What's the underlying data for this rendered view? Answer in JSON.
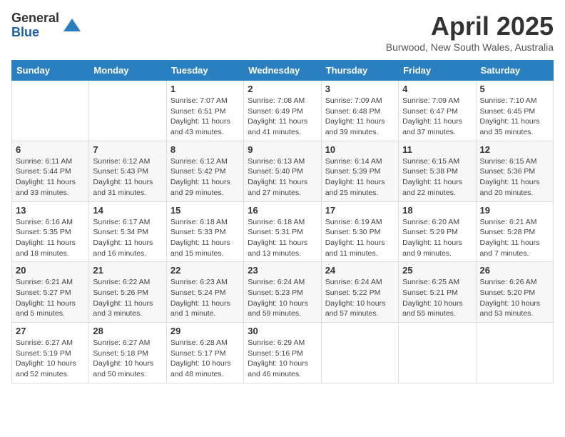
{
  "logo": {
    "general": "General",
    "blue": "Blue"
  },
  "title": "April 2025",
  "location": "Burwood, New South Wales, Australia",
  "days_of_week": [
    "Sunday",
    "Monday",
    "Tuesday",
    "Wednesday",
    "Thursday",
    "Friday",
    "Saturday"
  ],
  "weeks": [
    [
      {
        "day": "",
        "info": ""
      },
      {
        "day": "",
        "info": ""
      },
      {
        "day": "1",
        "info": "Sunrise: 7:07 AM\nSunset: 6:51 PM\nDaylight: 11 hours and 43 minutes."
      },
      {
        "day": "2",
        "info": "Sunrise: 7:08 AM\nSunset: 6:49 PM\nDaylight: 11 hours and 41 minutes."
      },
      {
        "day": "3",
        "info": "Sunrise: 7:09 AM\nSunset: 6:48 PM\nDaylight: 11 hours and 39 minutes."
      },
      {
        "day": "4",
        "info": "Sunrise: 7:09 AM\nSunset: 6:47 PM\nDaylight: 11 hours and 37 minutes."
      },
      {
        "day": "5",
        "info": "Sunrise: 7:10 AM\nSunset: 6:45 PM\nDaylight: 11 hours and 35 minutes."
      }
    ],
    [
      {
        "day": "6",
        "info": "Sunrise: 6:11 AM\nSunset: 5:44 PM\nDaylight: 11 hours and 33 minutes."
      },
      {
        "day": "7",
        "info": "Sunrise: 6:12 AM\nSunset: 5:43 PM\nDaylight: 11 hours and 31 minutes."
      },
      {
        "day": "8",
        "info": "Sunrise: 6:12 AM\nSunset: 5:42 PM\nDaylight: 11 hours and 29 minutes."
      },
      {
        "day": "9",
        "info": "Sunrise: 6:13 AM\nSunset: 5:40 PM\nDaylight: 11 hours and 27 minutes."
      },
      {
        "day": "10",
        "info": "Sunrise: 6:14 AM\nSunset: 5:39 PM\nDaylight: 11 hours and 25 minutes."
      },
      {
        "day": "11",
        "info": "Sunrise: 6:15 AM\nSunset: 5:38 PM\nDaylight: 11 hours and 22 minutes."
      },
      {
        "day": "12",
        "info": "Sunrise: 6:15 AM\nSunset: 5:36 PM\nDaylight: 11 hours and 20 minutes."
      }
    ],
    [
      {
        "day": "13",
        "info": "Sunrise: 6:16 AM\nSunset: 5:35 PM\nDaylight: 11 hours and 18 minutes."
      },
      {
        "day": "14",
        "info": "Sunrise: 6:17 AM\nSunset: 5:34 PM\nDaylight: 11 hours and 16 minutes."
      },
      {
        "day": "15",
        "info": "Sunrise: 6:18 AM\nSunset: 5:33 PM\nDaylight: 11 hours and 15 minutes."
      },
      {
        "day": "16",
        "info": "Sunrise: 6:18 AM\nSunset: 5:31 PM\nDaylight: 11 hours and 13 minutes."
      },
      {
        "day": "17",
        "info": "Sunrise: 6:19 AM\nSunset: 5:30 PM\nDaylight: 11 hours and 11 minutes."
      },
      {
        "day": "18",
        "info": "Sunrise: 6:20 AM\nSunset: 5:29 PM\nDaylight: 11 hours and 9 minutes."
      },
      {
        "day": "19",
        "info": "Sunrise: 6:21 AM\nSunset: 5:28 PM\nDaylight: 11 hours and 7 minutes."
      }
    ],
    [
      {
        "day": "20",
        "info": "Sunrise: 6:21 AM\nSunset: 5:27 PM\nDaylight: 11 hours and 5 minutes."
      },
      {
        "day": "21",
        "info": "Sunrise: 6:22 AM\nSunset: 5:26 PM\nDaylight: 11 hours and 3 minutes."
      },
      {
        "day": "22",
        "info": "Sunrise: 6:23 AM\nSunset: 5:24 PM\nDaylight: 11 hours and 1 minute."
      },
      {
        "day": "23",
        "info": "Sunrise: 6:24 AM\nSunset: 5:23 PM\nDaylight: 10 hours and 59 minutes."
      },
      {
        "day": "24",
        "info": "Sunrise: 6:24 AM\nSunset: 5:22 PM\nDaylight: 10 hours and 57 minutes."
      },
      {
        "day": "25",
        "info": "Sunrise: 6:25 AM\nSunset: 5:21 PM\nDaylight: 10 hours and 55 minutes."
      },
      {
        "day": "26",
        "info": "Sunrise: 6:26 AM\nSunset: 5:20 PM\nDaylight: 10 hours and 53 minutes."
      }
    ],
    [
      {
        "day": "27",
        "info": "Sunrise: 6:27 AM\nSunset: 5:19 PM\nDaylight: 10 hours and 52 minutes."
      },
      {
        "day": "28",
        "info": "Sunrise: 6:27 AM\nSunset: 5:18 PM\nDaylight: 10 hours and 50 minutes."
      },
      {
        "day": "29",
        "info": "Sunrise: 6:28 AM\nSunset: 5:17 PM\nDaylight: 10 hours and 48 minutes."
      },
      {
        "day": "30",
        "info": "Sunrise: 6:29 AM\nSunset: 5:16 PM\nDaylight: 10 hours and 46 minutes."
      },
      {
        "day": "",
        "info": ""
      },
      {
        "day": "",
        "info": ""
      },
      {
        "day": "",
        "info": ""
      }
    ]
  ]
}
